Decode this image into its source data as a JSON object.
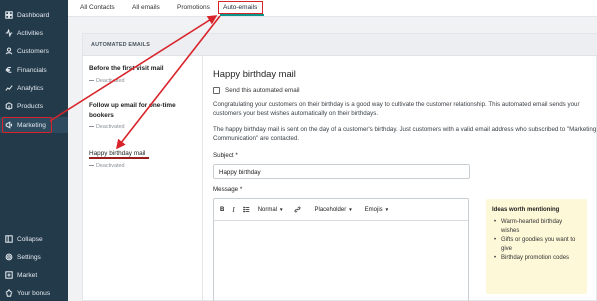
{
  "sidebar": {
    "items": [
      {
        "label": "Dashboard",
        "icon": "dashboard-icon"
      },
      {
        "label": "Activities",
        "icon": "activities-icon"
      },
      {
        "label": "Customers",
        "icon": "customers-icon"
      },
      {
        "label": "Financials",
        "icon": "financials-icon"
      },
      {
        "label": "Analytics",
        "icon": "analytics-icon"
      },
      {
        "label": "Products",
        "icon": "products-icon"
      },
      {
        "label": "Marketing",
        "icon": "marketing-icon",
        "active": true
      }
    ],
    "bottom_items": [
      {
        "label": "Collapse",
        "icon": "collapse-icon"
      },
      {
        "label": "Settings",
        "icon": "gear-icon"
      },
      {
        "label": "Market",
        "icon": "market-icon"
      },
      {
        "label": "Your bonus",
        "icon": "bonus-icon"
      }
    ]
  },
  "tabs": [
    {
      "label": "All Contacts"
    },
    {
      "label": "All emails"
    },
    {
      "label": "Promotions"
    },
    {
      "label": "Auto-emails",
      "active": true
    }
  ],
  "section_header": "AUTOMATED EMAILS",
  "email_list": [
    {
      "title": "Before the first visit mail",
      "status": "Deactivated"
    },
    {
      "title": "Follow up email for one-time bookers",
      "status": "Deactivated"
    },
    {
      "title": "Happy birthday mail",
      "status": "Deactivated",
      "selected": true
    }
  ],
  "detail": {
    "title": "Happy birthday mail",
    "send_checkbox_label": "Send this automated email",
    "send_checked": false,
    "description_1": "Congratulating your customers on their birthday is a good way to cultivate the customer relationship. This automated email sends your customers your best wishes automatically on their birthdays.",
    "description_2": "The happy birthday mail is sent on the day of a customer's birthday. Just customers with a valid email address who subscribed to \"Marketing Communication\" are contacted.",
    "subject_label": "Subject *",
    "subject_value": "Happy birthday",
    "message_label": "Message *",
    "toolbar": {
      "bold": "B",
      "italic": "I",
      "format": "Normal",
      "placeholder": "Placeholder",
      "emojis": "Emojis"
    },
    "ideas": {
      "title": "Ideas worth mentioning",
      "items": [
        "Warm-hearted birthday wishes",
        "Gifts or goodies you want to give",
        "Birthday promotion codes"
      ]
    }
  },
  "colors": {
    "sidebar_bg": "#233a4b",
    "accent": "#0d9488",
    "highlight_red": "#d8232a",
    "ideas_bg": "#fdf8d8"
  }
}
